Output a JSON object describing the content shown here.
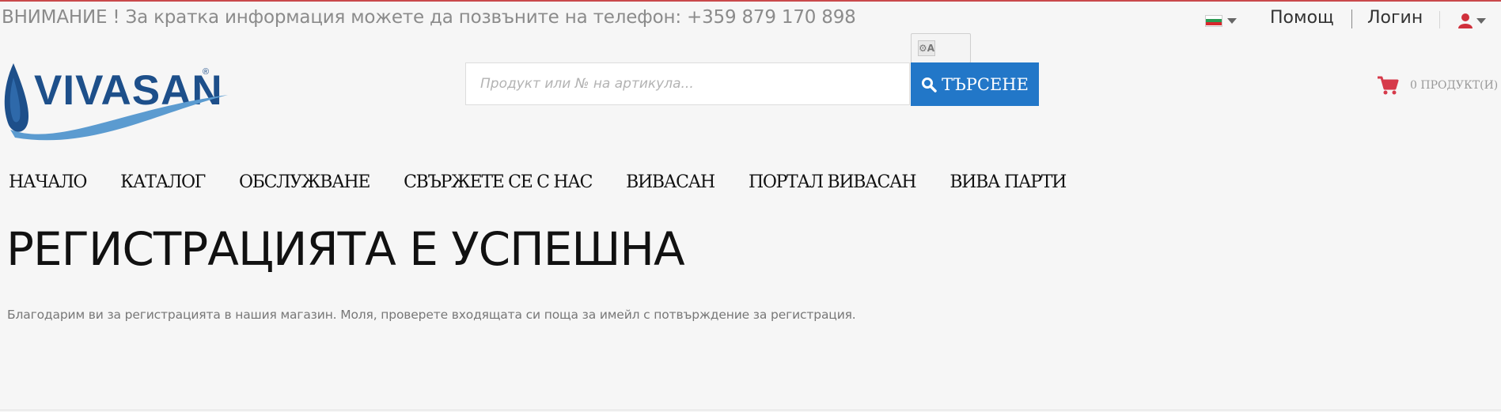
{
  "topbar": {
    "notice": "ВНИМАНИЕ ! За кратка информация можете да позвъните на телефон: +359 879 170 898",
    "help_label": "Помощ",
    "login_label": "Логин",
    "language_icon": "bulgarian-flag-icon",
    "user_icon": "user-icon"
  },
  "logo": {
    "text": "VIVASAN",
    "mark": "®"
  },
  "search": {
    "placeholder": "Продукт или № на артикула...",
    "button_label": "ТЪРСЕНЕ",
    "icon": "search-icon"
  },
  "translate_widget": {
    "icon": "translate-icon"
  },
  "cart": {
    "label": "0 ПРОДУКТ(И)",
    "icon": "shopping-cart-icon"
  },
  "nav": {
    "items": [
      "НАЧАЛО",
      "КАТАЛОГ",
      "ОБСЛУЖВАНЕ",
      "СВЪРЖЕТЕ СЕ С НАС",
      "ВИВАСАН",
      "ПОРТАЛ ВИВАСАН",
      "ВИВА ПАРТИ"
    ]
  },
  "main": {
    "title": "РЕГИСТРАЦИЯТА Е УСПЕШНА",
    "message": "Благодарим ви за регистрацията в нашия магазин. Моля, проверете входящата си поща за имейл с потвърждение за регистрация."
  },
  "colors": {
    "accent": "#2277c8",
    "top_line": "#c9494b",
    "cart": "#d63a4a",
    "logo_blue": "#1d4f8a",
    "background": "#f6f6f6"
  }
}
